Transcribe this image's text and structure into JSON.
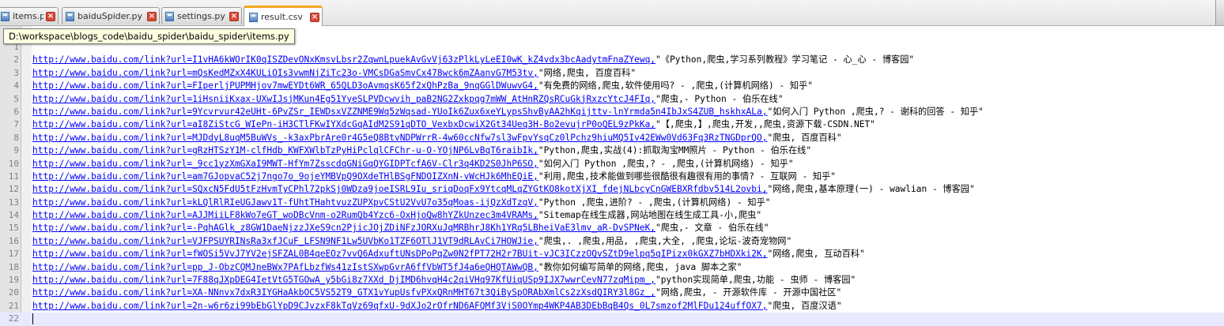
{
  "tabs": [
    {
      "label": "items.py",
      "active": false
    },
    {
      "label": "baiduSpider.py",
      "active": false
    },
    {
      "label": "settings.py",
      "active": false
    },
    {
      "label": "result.csv",
      "active": true
    }
  ],
  "tooltip": "D:\\workspace\\blogs_code\\baidu_spider\\baidu_spider\\items.py",
  "colors": {
    "url": "#0000ff",
    "active_tab_accent": "#f5a623",
    "current_line": "#e8e8ff"
  },
  "lines": [
    {
      "num": "1",
      "url": "",
      "rest": ""
    },
    {
      "num": "2",
      "url": "http://www.baidu.com/link?url=I1vHA6kWOrIK0qISZDevONxKmsvLbsr2ZqwnLpuekAvGvVj63zPlkLyLeEI0wK_kZ4vdx3bcAadytmFnaZYewq,",
      "rest": "\"《Python,爬虫,学习系列教程》学习笔记 - 心_心 - 博客园\""
    },
    {
      "num": "3",
      "url": "http://www.baidu.com/link?url=mQsKedMZxX4KULiOIs3vwmNjZiTc23o-VMCsDGaSmvCx478wck6mZAanvG7M53tv,",
      "rest": "\"网络,爬虫, 百度百科\""
    },
    {
      "num": "4",
      "url": "http://www.baidu.com/link?url=FIperljPUPMHjov7mwEYDt6WR_65QLD3oAvmqsK65f2xQhPzBa_9nqGGlDWuwvG4,",
      "rest": "\"有免费的网络,爬虫,软件使用吗? - ,爬虫,(计算机网络) - 知乎\""
    },
    {
      "num": "5",
      "url": "http://www.baidu.com/link?url=1iHsniiKxax-UXwIJsjMKun4Eg51YyeSLPVDcwvih_paB2NG2Zxkpqg7mWW_AtHnRZQsRCuGkjRxzcYtcJ4FIq,",
      "rest": "\"爬虫,- Python - 伯乐在线\""
    },
    {
      "num": "6",
      "url": "http://www.baidu.com/link?url=9Ycvrvur42eUHt-6PvZSr_IEWDsxVZZNME9Wq5zWqsad-YUoIk6Zux6xeYLypsShvByAA2hKqijttv-lnYrmda5n4IbJxS4ZUB_hskhxALa,",
      "rest": "\"如何入门 Python ,爬虫,? - 谢科的回答 - 知乎\""
    },
    {
      "num": "7",
      "url": "http://www.baidu.com/link?url=aI8ZiStcG_WIePn-iH3CTlFKwIYXdcGqAIdM2S91qDTO_VexbxDcwiX2Gt34Ueq3H-Bo2evujrP0oQEL9zPkKa,",
      "rest": "\"【,爬虫,】,爬虫,开发,,爬虫,资源下载-CSDN.NET\""
    },
    {
      "num": "8",
      "url": "http://www.baidu.com/link?url=MJDdyL8uqM5BuWVs_-k3axPbrAre0r4G5eQ8BtvNDPWrrR-4w60ccNfw7sl3wFpvYsqCz0lPchz9hiuMQ5Iv42EWw0Vd63Fq3RzTNGDprQO,",
      "rest": "\"爬虫, 百度百科\""
    },
    {
      "num": "9",
      "url": "http://www.baidu.com/link?url=gRzHTSzY1M-clfHdb_KWFXWlbTzPyHiPclqlCFChr-u-O-YOjNP6LvBqT6raibIk,",
      "rest": "\"Python,爬虫,实战(4):抓取淘宝MM照片 - Python - 伯乐在线\""
    },
    {
      "num": "10",
      "url": "http://www.baidu.com/link?url=_9cc1yzXmGXaI9MWT-HfYm7ZsscdqGNiGqQYGIDPTcfA6V-Clr3q4KD2S0JhP6SO,",
      "rest": "\"如何入门 Python ,爬虫,? - ,爬虫,(计算机网络) - 知乎\""
    },
    {
      "num": "11",
      "url": "http://www.baidu.com/link?url=am7GJopvaC52j7ngo7o_9ojeYMBVpQ9OXdeTHlBSgFNDOIZXnN-vWcHJk6MhEQiE,",
      "rest": "\"利用,爬虫,技术能做到哪些很酷很有趣很有用的事情? - 互联网 - 知乎\""
    },
    {
      "num": "12",
      "url": "http://www.baidu.com/link?url=SQxcN5FdU5tFzHvmTyCPhl72pkSj0WDza9joeISRL9Iu_sriqDoqFx9YtcqMLqZYGtKO8kotXjXI_fdejNLbcyCnGWEBXRfdbv514L2ovbi,",
      "rest": "\"网络,爬虫,基本原理(一) - wawlian - 博客园\""
    },
    {
      "num": "13",
      "url": "http://www.baidu.com/link?url=kLQlRlRIeUGJawv1T-fUhtTHahtvuzZUPXpvCStU2VvU7o35qMoas-ijQzXdTzqV,",
      "rest": "\"Python ,爬虫,进阶? - ,爬虫,(计算机网络) - 知乎\""
    },
    {
      "num": "14",
      "url": "http://www.baidu.com/link?url=AJJMiiLF8kWo7eGT_woDBcVnm-o2RumQb4Yzc6-OxHjoQw8hYZkUnzec3m4VRAMs,",
      "rest": "\"Sitemap在线生成器,网站地图在线生成工具-小,爬虫\""
    },
    {
      "num": "15",
      "url": "http://www.baidu.com/link?url=-PqhAGlk_z8GW1DaeNjzzJXeS9cn2PjicJOjZDiNFzJORXuJqMRBhrJ8Kh1YRq5LBheiVaE3lmv_aR-DvSPNeK,",
      "rest": "\"爬虫,- 文章 - 伯乐在线\""
    },
    {
      "num": "16",
      "url": "http://www.baidu.com/link?url=VJFPSUYRINsRa3xfJCuF_LFSN9NF1Lw5UVbKo1TZF6OTlJ1VT9dRLAvCi7HOWJie,",
      "rest": "\"爬虫,. ,爬虫,用品, ,爬虫,大全, ,爬虫,论坛-波奇宠物网\""
    },
    {
      "num": "17",
      "url": "http://www.baidu.com/link?url=fWOSi5VvJ7YV2ejSFZAL0B4qeEOz7vvQ6AdxuftUNsDPoPqZw0N2fPT72H2r7BUit-vJC3ICzzOQvSZtD9elpq5qIPizx0kGXZ7bHDXki2K,",
      "rest": "\"网络,爬虫, 互动百科\""
    },
    {
      "num": "18",
      "url": "http://www.baidu.com/link?url=pp_J-ObzCQMJneBWx7PAfLbzfWs41zIstSXwpGvrA6ffVbWT5fJ4a6eQHQTAWwQB,",
      "rest": "\"教你如何编写简单的网络,爬虫, java 脚本之家\""
    },
    {
      "num": "19",
      "url": "http://www.baidu.com/link?url=7F88qJXpDEG4IetVtG5TGOwA_y5bGi8z7XXd_DjIMD6hvqH4c2qiVHq97KfUiqUSp9IJX7wwrCevN77zqMipm_,",
      "rest": "\"python实现简单,爬虫,功能 - 虫师 - 博客园\""
    },
    {
      "num": "20",
      "url": "http://www.baidu.com/link?url=XA-NNnvx7dxR3IYGHaAkbOC5VS52T9_GTX1vYupUsfvPXxQRnMHT67t3QiBySpORAbXmlCs2zXsdQIRY3l8Gz_,",
      "rest": "\"网络,爬虫, - 开源软件库 - 开源中国社区\""
    },
    {
      "num": "21",
      "url": "http://www.baidu.com/link?url=2n-w6r6zi99bEbGlYpD9CJvzxF8kTqVz69qfxU-9dXJo2rOfrND6AFQMf3VjS0OYmp4WKP4AB3DEbBqB4Qs_0L7smzof2MlFDu124uffOX7,",
      "rest": "\"爬虫, 百度汉语\""
    },
    {
      "num": "22",
      "url": "",
      "rest": ""
    }
  ]
}
